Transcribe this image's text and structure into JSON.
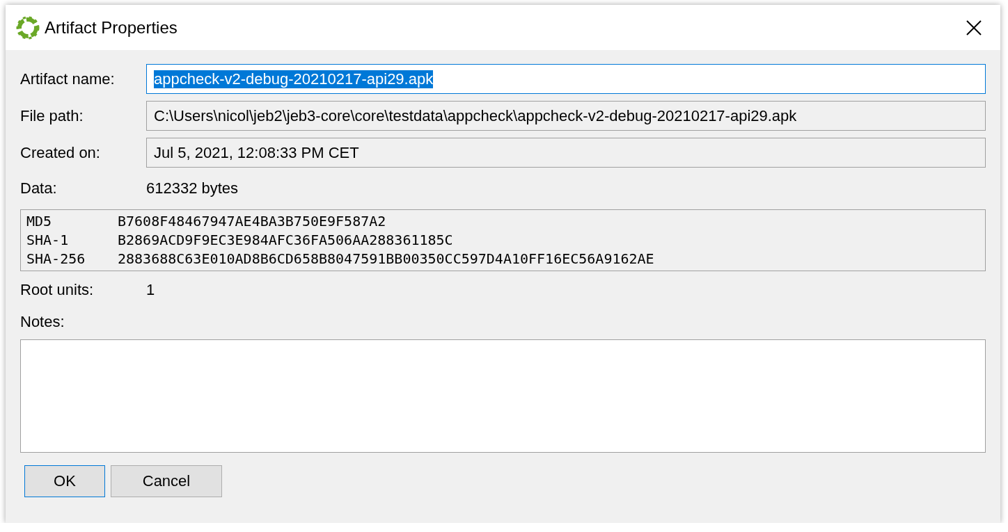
{
  "window": {
    "title": "Artifact Properties"
  },
  "fields": [
    {
      "label": "Artifact name:",
      "value": "appcheck-v2-debug-20210217-api29.apk",
      "editable": true,
      "text_selected": true
    },
    {
      "label": "File path:",
      "value": "C:\\Users\\nicol\\jeb2\\jeb3-core\\core\\testdata\\appcheck\\appcheck-v2-debug-20210217-api29.apk",
      "editable": false,
      "text_selected": false
    },
    {
      "label": "Created on:",
      "value": "Jul 5, 2021, 12:08:33 PM CET",
      "editable": false,
      "text_selected": false
    }
  ],
  "data": {
    "label": "Data:",
    "value": "612332 bytes"
  },
  "hashes": [
    {
      "algorithm": "MD5",
      "digest": "B7608F48467947AE4BA3B750E9F587A2"
    },
    {
      "algorithm": "SHA-1",
      "digest": "B2869ACD9F9EC3E984AFC36FA506AA288361185C"
    },
    {
      "algorithm": "SHA-256",
      "digest": "2883688C63E010AD8B6CD658B8047591BB00350CC597D4A10FF16EC56A9162AE"
    }
  ],
  "root_units": {
    "label": "Root units:",
    "value": "1"
  },
  "notes": {
    "label": "Notes:"
  },
  "buttons": [
    {
      "label": "OK",
      "default": true
    },
    {
      "label": "Cancel",
      "default": false
    }
  ]
}
